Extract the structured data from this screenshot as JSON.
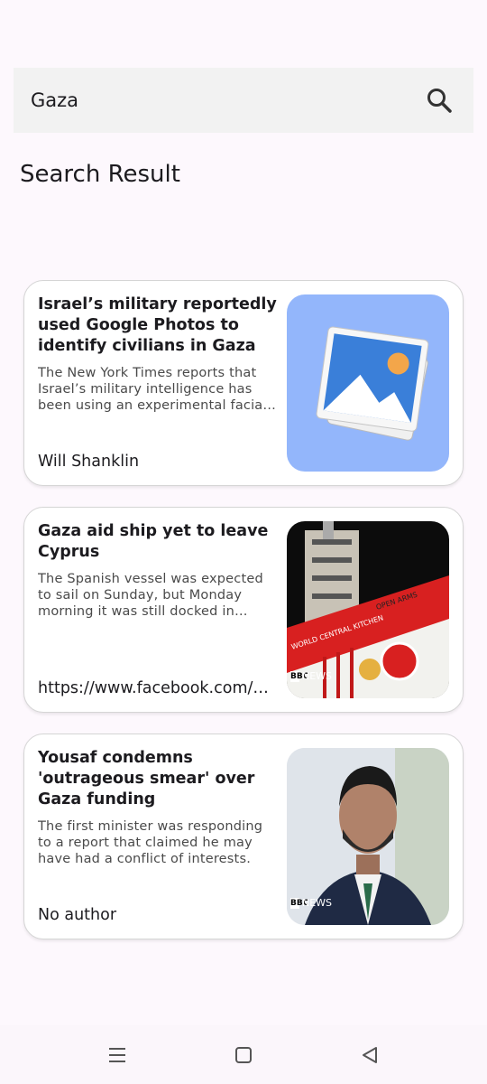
{
  "search": {
    "value": "Gaza",
    "placeholder": ""
  },
  "page": {
    "title": "Search Result"
  },
  "results": [
    {
      "title": "Israel’s military reportedly used Google Photos to identify civilians in Gaza",
      "description": "The New York Times reports that Israel’s military intelligence has been using an experimental facial recognition program",
      "author": "Will Shanklin",
      "thumbnail": "image-placeholder-icon"
    },
    {
      "title": "Gaza aid ship yet to leave Cyprus",
      "description": "The Spanish vessel was expected to sail on Sunday, but Monday morning it was still docked in Larnaca",
      "author": "https://www.facebook.com/bbcnews",
      "thumbnail": "aid-ship-photo",
      "badge_logo": "BBC",
      "badge_text": "NEWS",
      "ship_labels": [
        "WORLD CENTRAL KITCHEN",
        "OPEN ARMS"
      ]
    },
    {
      "title": "Yousaf condemns 'outrageous smear' over Gaza funding",
      "description": "The first minister was responding to a report that claimed he may have had a conflict of interests.",
      "author": "No author",
      "thumbnail": "person-photo",
      "badge_logo": "BBC",
      "badge_text": "NEWS"
    }
  ],
  "nav": {
    "icons": [
      "menu-icon",
      "home-square-icon",
      "back-triangle-icon"
    ]
  },
  "colors": {
    "background": "#fdf8fd",
    "search_bg": "#f2f2f2",
    "thumb_blue": "#93b6fb"
  }
}
